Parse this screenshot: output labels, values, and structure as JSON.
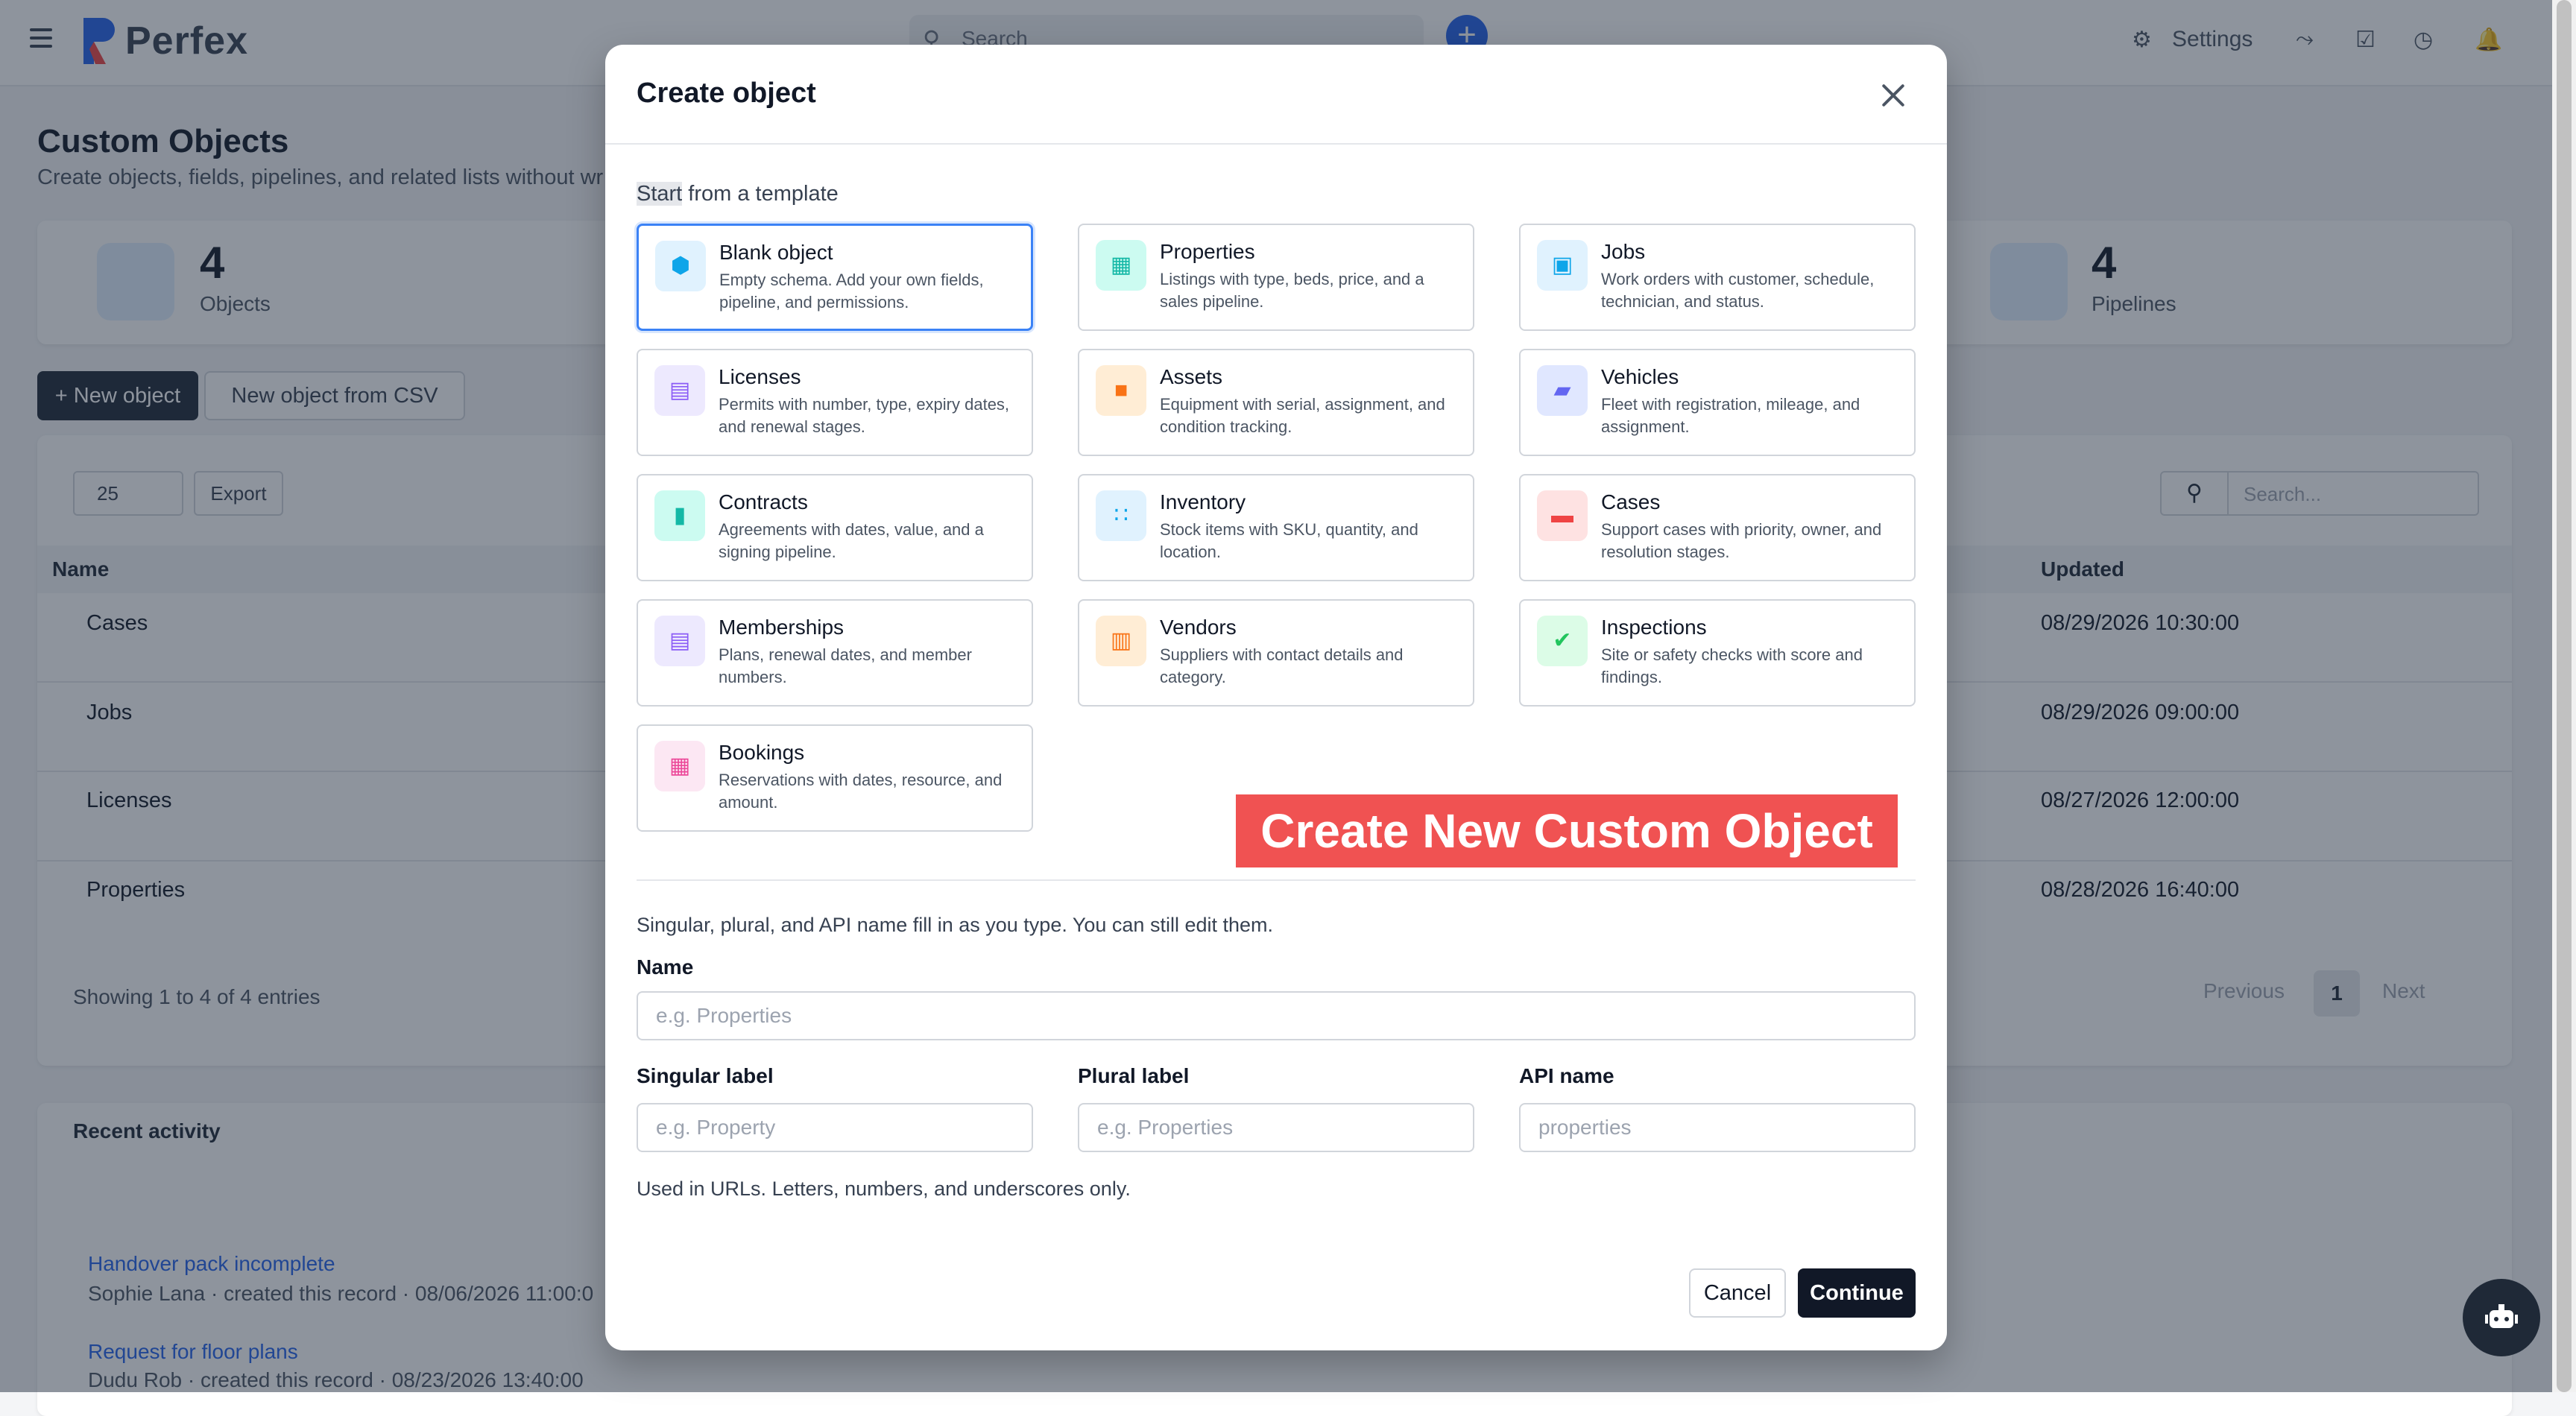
{
  "header": {
    "logo_text": "Perfex",
    "search_placeholder": "Search",
    "settings_label": "Settings"
  },
  "page": {
    "title": "Custom Objects",
    "subtitle": "Create objects, fields, pipelines, and related lists without wr",
    "stats": [
      {
        "value": "4",
        "label": "Objects",
        "icon": "cubes-icon"
      },
      {
        "value": "4",
        "label": "Pipelines",
        "icon": "columns-icon"
      }
    ],
    "new_object_label": "+ New object",
    "new_csv_label": "New object from CSV",
    "page_size": "25",
    "export_label": "Export",
    "search_placeholder": "Search...",
    "col_name": "Name",
    "col_updated": "Updated",
    "rows": [
      {
        "name": "Cases",
        "updated": "08/29/2026 10:30:00"
      },
      {
        "name": "Jobs",
        "updated": "08/29/2026 09:00:00"
      },
      {
        "name": "Licenses",
        "updated": "08/27/2026 12:00:00"
      },
      {
        "name": "Properties",
        "updated": "08/28/2026 16:40:00"
      }
    ],
    "showing": "Showing 1 to 4 of 4 entries",
    "prev_label": "Previous",
    "page_num": "1",
    "next_label": "Next",
    "recent_title": "Recent activity",
    "activity": [
      {
        "link": "Handover pack incomplete",
        "meta": "Sophie Lana · created this record · 08/06/2026 11:00:0"
      },
      {
        "link": "Request for floor plans",
        "meta": "Dudu Rob · created this record · 08/23/2026 13:40:00"
      }
    ]
  },
  "modal": {
    "title": "Create object",
    "section_label_hl": "Start",
    "section_label_rest": " from a template",
    "templates": [
      {
        "name": "Blank object",
        "desc": "Empty schema. Add your own fields, pipeline, and permissions.",
        "icon": "cube-icon",
        "color": "#0ea5e9",
        "bg": "#e0f2fe"
      },
      {
        "name": "Properties",
        "desc": "Listings with type, beds, price, and a sales pipeline.",
        "icon": "building-icon",
        "color": "#14b8a6",
        "bg": "#ccfbf1"
      },
      {
        "name": "Jobs",
        "desc": "Work orders with customer, schedule, technician, and status.",
        "icon": "briefcase-icon",
        "color": "#0ea5e9",
        "bg": "#e0f2fe"
      },
      {
        "name": "Licenses",
        "desc": "Permits with number, type, expiry dates, and renewal stages.",
        "icon": "id-card-icon",
        "color": "#8b5cf6",
        "bg": "#ede9fe"
      },
      {
        "name": "Assets",
        "desc": "Equipment with serial, assignment, and condition tracking.",
        "icon": "box-icon",
        "color": "#f97316",
        "bg": "#ffedd5"
      },
      {
        "name": "Vehicles",
        "desc": "Fleet with registration, mileage, and assignment.",
        "icon": "car-icon",
        "color": "#6366f1",
        "bg": "#e0e7ff"
      },
      {
        "name": "Contracts",
        "desc": "Agreements with dates, value, and a signing pipeline.",
        "icon": "file-contract-icon",
        "color": "#14b8a6",
        "bg": "#ccfbf1"
      },
      {
        "name": "Inventory",
        "desc": "Stock items with SKU, quantity, and location.",
        "icon": "boxes-icon",
        "color": "#0ea5e9",
        "bg": "#e0f2fe"
      },
      {
        "name": "Cases",
        "desc": "Support cases with priority, owner, and resolution stages.",
        "icon": "ticket-icon",
        "color": "#ef4444",
        "bg": "#fee2e2"
      },
      {
        "name": "Memberships",
        "desc": "Plans, renewal dates, and member numbers.",
        "icon": "id-card-icon",
        "color": "#8b5cf6",
        "bg": "#ede9fe"
      },
      {
        "name": "Vendors",
        "desc": "Suppliers with contact details and category.",
        "icon": "store-icon",
        "color": "#f97316",
        "bg": "#ffedd5"
      },
      {
        "name": "Inspections",
        "desc": "Site or safety checks with score and findings.",
        "icon": "clipboard-check-icon",
        "color": "#22c55e",
        "bg": "#dcfce7"
      },
      {
        "name": "Bookings",
        "desc": "Reservations with dates, resource, and amount.",
        "icon": "calendar-icon",
        "color": "#ec4899",
        "bg": "#fce7f3"
      }
    ],
    "banner": "Create New Custom Object",
    "helper": "Singular, plural, and API name fill in as you type. You can still edit them.",
    "name_label": "Name",
    "name_placeholder": "e.g. Properties",
    "singular_label": "Singular label",
    "singular_placeholder": "e.g. Property",
    "plural_label": "Plural label",
    "plural_placeholder": "e.g. Properties",
    "api_label": "API name",
    "api_placeholder": "properties",
    "api_hint": "Used in URLs. Letters, numbers, and underscores only.",
    "cancel_label": "Cancel",
    "continue_label": "Continue"
  }
}
